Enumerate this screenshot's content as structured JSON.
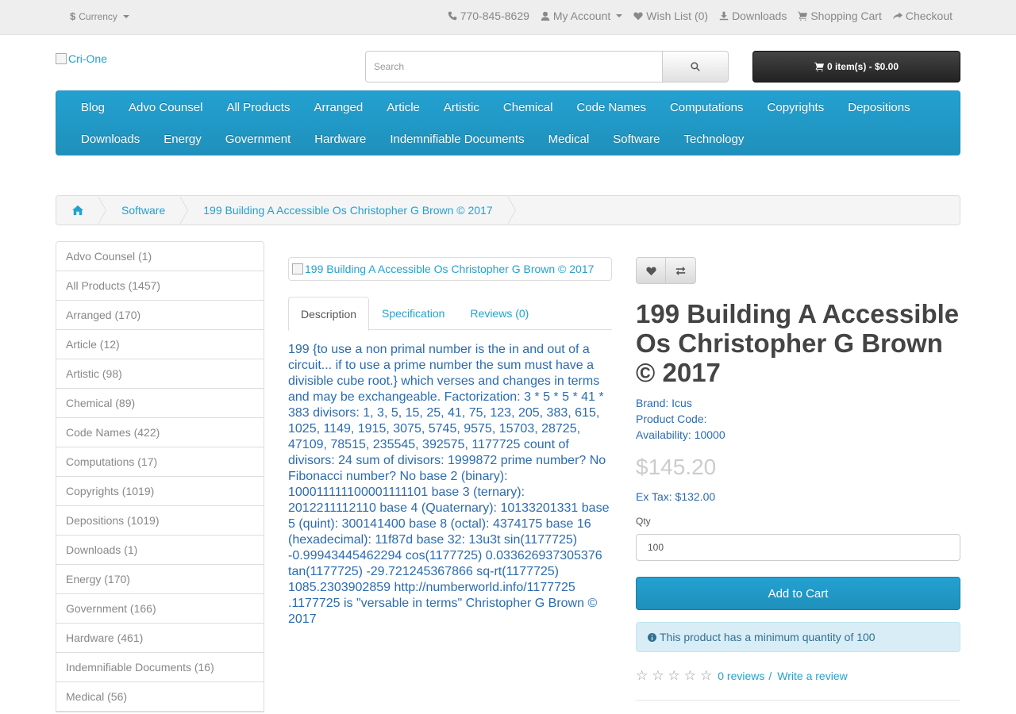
{
  "topbar": {
    "currency_label": "Currency",
    "phone": "770-845-8629",
    "my_account": "My Account",
    "wish_list": "Wish List (0)",
    "downloads": "Downloads",
    "shopping_cart": "Shopping Cart",
    "checkout": "Checkout"
  },
  "header": {
    "logo_alt": "Cri-One",
    "search_placeholder": "Search",
    "cart_label": "0 item(s) - $0.00"
  },
  "menu": {
    "row1": [
      "Blog",
      "Advo Counsel",
      "All Products",
      "Arranged",
      "Article",
      "Artistic",
      "Chemical",
      "Code Names",
      "Computations",
      "Copyrights",
      "Depositions"
    ],
    "row2": [
      "Downloads",
      "Energy",
      "Government",
      "Hardware",
      "Indemnifiable Documents",
      "Medical",
      "Software",
      "Technology"
    ]
  },
  "breadcrumb": {
    "category": "Software",
    "product": "199 Building A Accessible Os Christopher G Brown © 2017"
  },
  "sidebar": {
    "items": [
      "Advo Counsel (1)",
      "All Products (1457)",
      "Arranged (170)",
      "Article (12)",
      "Artistic (98)",
      "Chemical (89)",
      "Code Names (422)",
      "Computations (17)",
      "Copyrights (1019)",
      "Depositions (1019)",
      "Downloads (1)",
      "Energy (170)",
      "Government (166)",
      "Hardware (461)",
      "Indemnifiable Documents (16)",
      "Medical (56)"
    ]
  },
  "product": {
    "image_alt": "199 Building A Accessible Os Christopher G Brown © 2017",
    "tabs": [
      "Description",
      "Specification",
      "Reviews (0)"
    ],
    "description": "199 {to use a non primal number is the in and out of a circuit... if to use a prime number the sum must have a divisible cube root.} which verses and changes in terms and may be exchangeable. Factorization: 3 * 5 * 5 * 41 * 383 divisors: 1, 3, 5, 15, 25, 41, 75, 123, 205, 383, 615, 1025, 1149, 1915, 3075, 5745, 9575, 15703, 28725, 47109, 78515, 235545, 392575, 1177725 count of divisors: 24 sum of divisors: 1999872 prime number? No Fibonacci number? No base 2 (binary): 100011111100001111101 base 3 (ternary): 2012211112110 base 4 (Quaternary): 10133201331 base 5 (quint): 300141400 base 8 (octal): 4374175 base 16 (hexadecimal): 11f87d base 32: 13u3t sin(1177725) -0.99943445462294 cos(1177725) 0.033626937305376 tan(1177725) -29.721245367866 sq-rt(1177725) 1085.2303902859 http://numberworld.info/1177725 .1177725 is \"versable in terms\" Christopher G Brown © 2017",
    "title": "199 Building A Accessible Os Christopher G Brown © 2017",
    "brand_label": "Brand:",
    "brand": "Icus",
    "code_label": "Product Code:",
    "code": "",
    "availability_label": "Availability:",
    "availability": "10000",
    "price": "$145.20",
    "ex_tax": "Ex Tax: $132.00",
    "qty_label": "Qty",
    "qty_value": "100",
    "add_to_cart": "Add to Cart",
    "min_qty_notice": "This product has a minimum quantity of 100",
    "reviews_link": "0 reviews",
    "write_review": "Write a review",
    "rating": 0
  },
  "colors": {
    "accent": "#23a1d1",
    "text_link": "#2b6bb0",
    "cart_dark": "#222222",
    "alert_bg": "#d9edf7"
  }
}
